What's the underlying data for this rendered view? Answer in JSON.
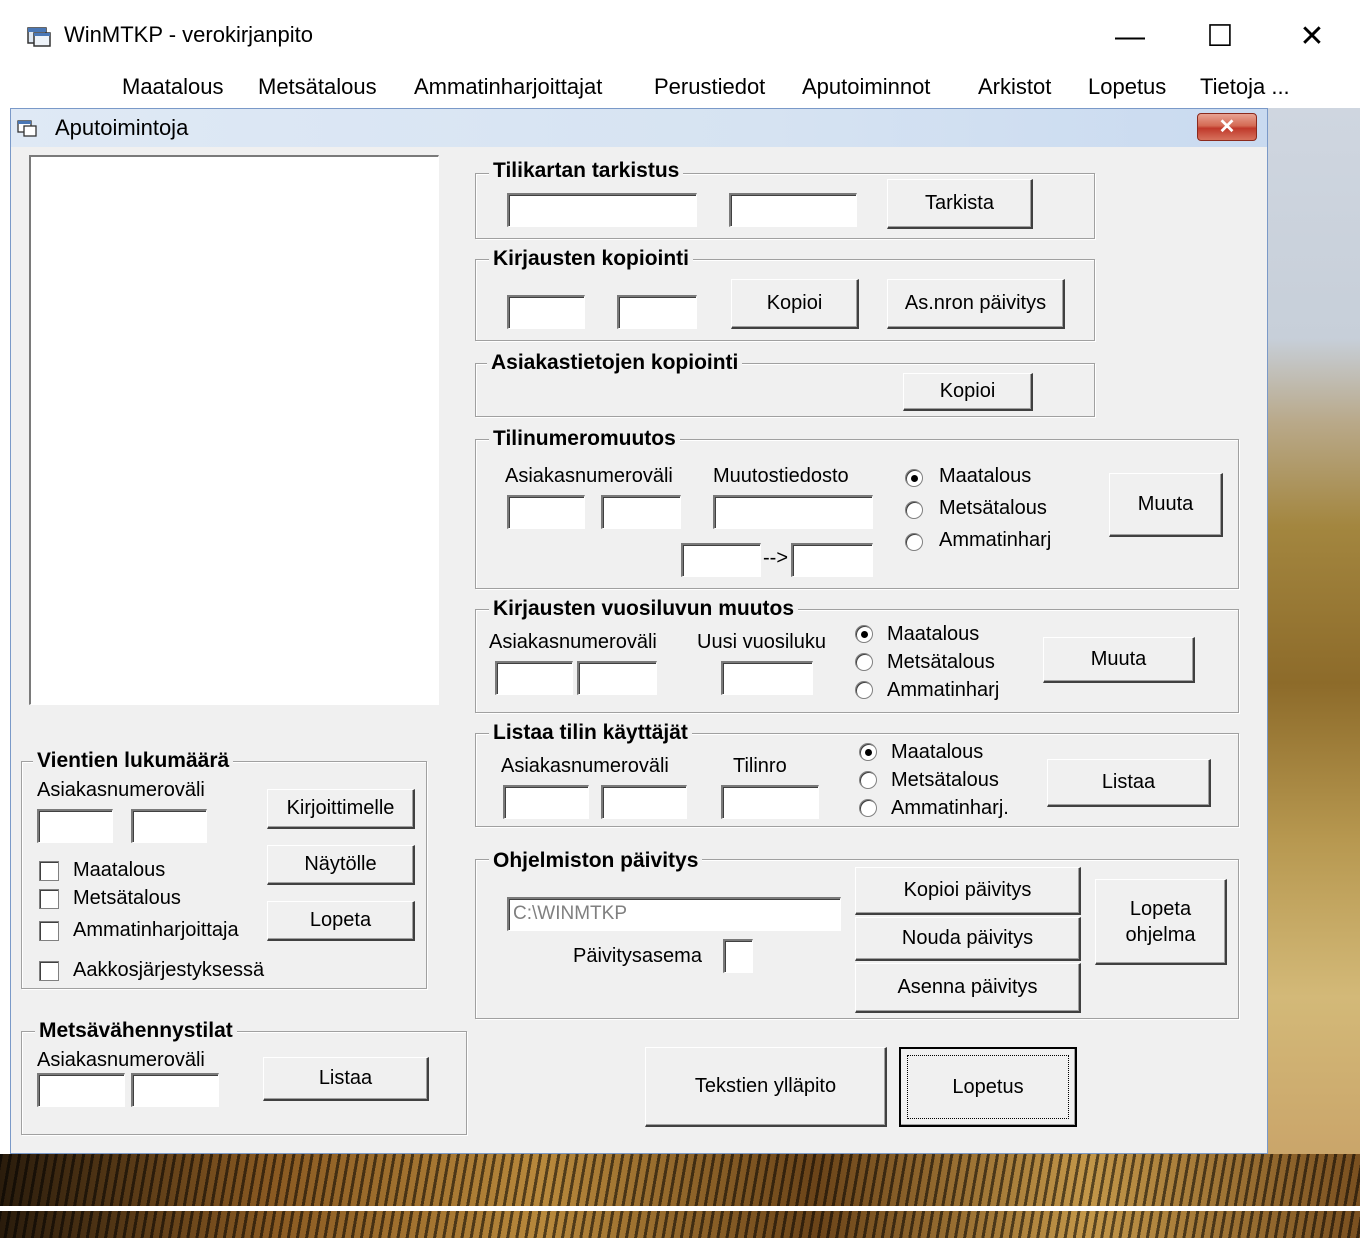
{
  "window": {
    "title": "WinMTKP - verokirjanpito",
    "controls": {
      "minimize": "—",
      "maximize": "☐",
      "close": "✕"
    }
  },
  "menu": [
    "Maatalous",
    "Metsätalous",
    "Ammatinharjoittajat",
    "Perustiedot",
    "Aputoiminnot",
    "Arkistot",
    "Lopetus",
    "Tietoja ..."
  ],
  "child": {
    "title": "Aputoimintoja",
    "close_label": "✕"
  },
  "tilikartan": {
    "title": "Tilikartan tarkistus",
    "button": "Tarkista"
  },
  "kirjausten_kopiointi": {
    "title": "Kirjausten kopiointi",
    "copy_button": "Kopioi",
    "update_button": "As.nron päivitys"
  },
  "asiakastietojen": {
    "title": "Asiakastietojen kopiointi",
    "button": "Kopioi"
  },
  "tilinumeromuutos": {
    "title": "Tilinumeromuutos",
    "label_range": "Asiakasnumeroväli",
    "label_file": "Muutostiedosto",
    "arrow": "-->",
    "radios": [
      "Maatalous",
      "Metsätalous",
      "Ammatinharj"
    ],
    "selected": 0,
    "button": "Muuta"
  },
  "vuosiluku": {
    "title": "Kirjausten vuosiluvun muutos",
    "label_range": "Asiakasnumeroväli",
    "label_year": "Uusi vuosiluku",
    "radios": [
      "Maatalous",
      "Metsätalous",
      "Ammatinharj"
    ],
    "selected": 0,
    "button": "Muuta"
  },
  "listaa_tilin": {
    "title": "Listaa tilin käyttäjät",
    "label_range": "Asiakasnumeroväli",
    "label_account": "Tilinro",
    "radios": [
      "Maatalous",
      "Metsätalous",
      "Ammatinharj."
    ],
    "selected": 0,
    "button": "Listaa"
  },
  "paivitys": {
    "title": "Ohjelmiston päivitys",
    "path_value": "C:\\WINMTKP",
    "label_station": "Päivitysasema",
    "copy_button": "Kopioi päivitys",
    "fetch_button": "Nouda päivitys",
    "install_button": "Asenna päivitys",
    "quit_label_1": "Lopeta",
    "quit_label_2": "ohjelma"
  },
  "vientien": {
    "title": "Vientien lukumäärä",
    "label_range": "Asiakasnumeroväli",
    "checks": [
      "Maatalous",
      "Metsätalous",
      "Ammatinharjoittaja",
      "Aakkosjärjestyksessä"
    ],
    "printer_button": "Kirjoittimelle",
    "screen_button": "Näytölle",
    "quit_button": "Lopeta"
  },
  "metsavahennys": {
    "title": "Metsävähennystilat",
    "label_range": "Asiakasnumeroväli",
    "button": "Listaa"
  },
  "bottom": {
    "texts_button": "Tekstien ylläpito",
    "quit_button": "Lopetus"
  }
}
